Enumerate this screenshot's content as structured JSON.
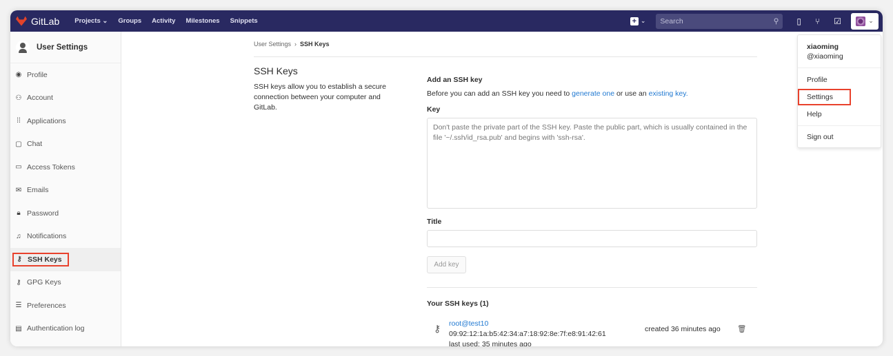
{
  "nav": {
    "brand": "GitLab",
    "links": [
      "Projects",
      "Groups",
      "Activity",
      "Milestones",
      "Snippets"
    ],
    "search_placeholder": "Search"
  },
  "sidebar": {
    "title": "User Settings",
    "items": [
      {
        "label": "Profile",
        "icon": "◉"
      },
      {
        "label": "Account",
        "icon": "⚇"
      },
      {
        "label": "Applications",
        "icon": "⁞⁞"
      },
      {
        "label": "Chat",
        "icon": "▢"
      },
      {
        "label": "Access Tokens",
        "icon": "▭"
      },
      {
        "label": "Emails",
        "icon": "✉"
      },
      {
        "label": "Password",
        "icon": "🔒︎"
      },
      {
        "label": "Notifications",
        "icon": "♫"
      },
      {
        "label": "SSH Keys",
        "icon": "⚷"
      },
      {
        "label": "GPG Keys",
        "icon": "⚷"
      },
      {
        "label": "Preferences",
        "icon": "☰"
      },
      {
        "label": "Authentication log",
        "icon": "▤"
      }
    ],
    "active": "SSH Keys"
  },
  "breadcrumb": {
    "parent": "User Settings",
    "current": "SSH Keys"
  },
  "intro": {
    "title": "SSH Keys",
    "description": "SSH keys allow you to establish a secure connection between your computer and GitLab."
  },
  "form": {
    "heading": "Add an SSH key",
    "help_pre": "Before you can add an SSH key you need to ",
    "link1": "generate one",
    "help_mid": " or use an ",
    "link2": "existing key.",
    "key_label": "Key",
    "key_placeholder": "Don't paste the private part of the SSH key. Paste the public part, which is usually contained in the file '~/.ssh/id_rsa.pub' and begins with 'ssh-rsa'.",
    "title_label": "Title",
    "title_value": "",
    "add_button": "Add key"
  },
  "keys": {
    "heading": "Your SSH keys (1)",
    "items": [
      {
        "title": "root@test10",
        "fingerprint": "09:92:12:1a:b5:42:34:a7:18:92:8e:7f:e8:91:42:61",
        "last_used": "last used: 35 minutes ago",
        "created": "created 36 minutes ago"
      }
    ]
  },
  "dropdown": {
    "name": "xiaoming",
    "username": "@xiaoming",
    "items": [
      "Profile",
      "Settings",
      "Help"
    ],
    "signout": "Sign out",
    "highlighted": "Settings"
  },
  "colors": {
    "navbar": "#292961",
    "link": "#1f78d1",
    "highlight": "#e8412c"
  }
}
